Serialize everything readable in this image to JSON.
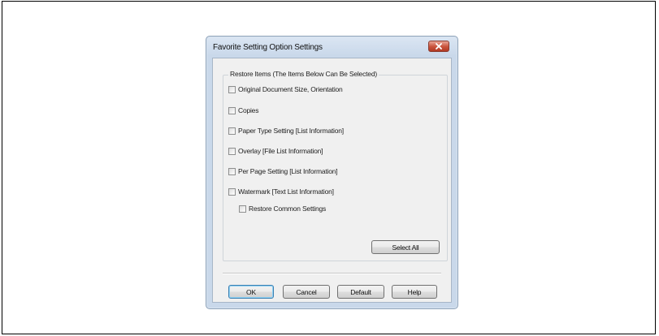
{
  "dialog": {
    "title": "Favorite Setting Option Settings",
    "group_label": "Restore Items (The Items Below Can Be Selected)",
    "items": [
      {
        "label": "Original Document Size, Orientation",
        "checked": false
      },
      {
        "label": "Copies",
        "checked": false
      },
      {
        "label": "Paper Type Setting [List Information]",
        "checked": false
      },
      {
        "label": "Overlay [File List Information]",
        "checked": false
      },
      {
        "label": "Per Page Setting [List Information]",
        "checked": false
      },
      {
        "label": "Watermark [Text List Information]",
        "checked": false
      }
    ],
    "sub_item": {
      "label": "Restore Common Settings",
      "checked": false
    },
    "select_all_label": "Select All",
    "buttons": {
      "ok": "OK",
      "cancel": "Cancel",
      "default": "Default",
      "help": "Help"
    },
    "close_icon": "close-x-icon",
    "colors": {
      "close_button": "#c9523b",
      "dialog_frame": "#c9d8ea",
      "client_bg": "#f0f0f0"
    }
  }
}
